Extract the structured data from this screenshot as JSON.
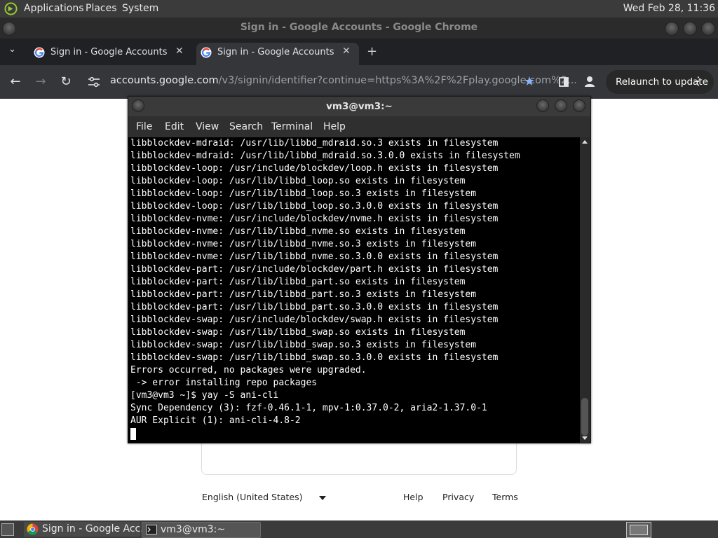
{
  "top_panel": {
    "menus": [
      "Applications",
      "Places",
      "System"
    ],
    "clock": "Wed Feb 28, 11:36"
  },
  "chrome": {
    "window_title": "Sign in - Google Accounts - Google Chrome",
    "tabs": [
      {
        "label": "Sign in - Google Accounts"
      },
      {
        "label": "Sign in - Google Accounts"
      }
    ],
    "url_host": "accounts.google.com",
    "url_path": "/v3/signin/identifier?continue=https%3A%2F%2Fplay.google.com%2...",
    "relaunch_label": "Relaunch to update"
  },
  "page": {
    "language": "English (United States)",
    "footer_links": [
      "Help",
      "Privacy",
      "Terms"
    ]
  },
  "terminal": {
    "title": "vm3@vm3:~",
    "menu": [
      "File",
      "Edit",
      "View",
      "Search",
      "Terminal",
      "Help"
    ],
    "lines": [
      "libblockdev-mdraid: /usr/lib/libbd_mdraid.so.3 exists in filesystem",
      "libblockdev-mdraid: /usr/lib/libbd_mdraid.so.3.0.0 exists in filesystem",
      "libblockdev-loop: /usr/include/blockdev/loop.h exists in filesystem",
      "libblockdev-loop: /usr/lib/libbd_loop.so exists in filesystem",
      "libblockdev-loop: /usr/lib/libbd_loop.so.3 exists in filesystem",
      "libblockdev-loop: /usr/lib/libbd_loop.so.3.0.0 exists in filesystem",
      "libblockdev-nvme: /usr/include/blockdev/nvme.h exists in filesystem",
      "libblockdev-nvme: /usr/lib/libbd_nvme.so exists in filesystem",
      "libblockdev-nvme: /usr/lib/libbd_nvme.so.3 exists in filesystem",
      "libblockdev-nvme: /usr/lib/libbd_nvme.so.3.0.0 exists in filesystem",
      "libblockdev-part: /usr/include/blockdev/part.h exists in filesystem",
      "libblockdev-part: /usr/lib/libbd_part.so exists in filesystem",
      "libblockdev-part: /usr/lib/libbd_part.so.3 exists in filesystem",
      "libblockdev-part: /usr/lib/libbd_part.so.3.0.0 exists in filesystem",
      "libblockdev-swap: /usr/include/blockdev/swap.h exists in filesystem",
      "libblockdev-swap: /usr/lib/libbd_swap.so exists in filesystem",
      "libblockdev-swap: /usr/lib/libbd_swap.so.3 exists in filesystem",
      "libblockdev-swap: /usr/lib/libbd_swap.so.3.0.0 exists in filesystem",
      "Errors occurred, no packages were upgraded.",
      " -> error installing repo packages",
      "[vm3@vm3 ~]$ yay -S ani-cli",
      "Sync Dependency (3): fzf-0.46.1-1, mpv-1:0.37.0-2, aria2-1.37.0-1",
      "AUR Explicit (1): ani-cli-4.8-2"
    ]
  },
  "taskbar": {
    "items": [
      {
        "label": "Sign in - Google Acc..."
      },
      {
        "label": "vm3@vm3:~"
      }
    ]
  }
}
